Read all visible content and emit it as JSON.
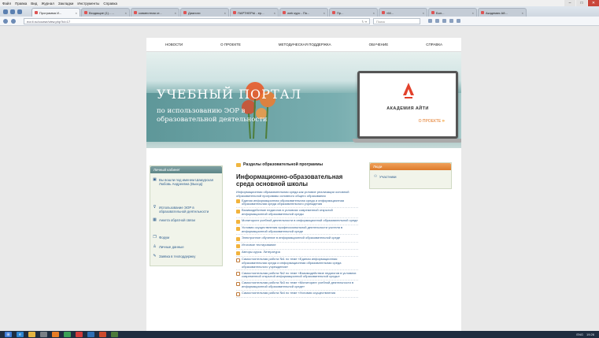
{
  "browser": {
    "menu": [
      "Файл",
      "Правка",
      "Вид",
      "Журнал",
      "Закладки",
      "Инструменты",
      "Справка"
    ],
    "tabs": [
      {
        "label": "Программа И...",
        "active": true
      },
      {
        "label": "Входящие (1) - ...",
        "active": false
      },
      {
        "label": "совместная ст...",
        "active": false
      },
      {
        "label": "Диалоги",
        "active": false
      },
      {
        "label": "ПАРТНЕРЫ - ер...",
        "active": false
      },
      {
        "label": "web курс - По...",
        "active": false
      },
      {
        "label": "Пр...",
        "active": false
      },
      {
        "label": "«М...",
        "active": false
      },
      {
        "label": "Бол...",
        "active": false
      },
      {
        "label": "Академия Ай...",
        "active": false
      }
    ],
    "url": "eor.it.ru/course/view.php?id=17",
    "search_placeholder": "Поиск",
    "window_buttons": [
      "–",
      "□",
      "✕"
    ]
  },
  "site": {
    "nav": [
      "НОВОСТИ",
      "О ПРОЕКТЕ",
      "МЕТОДИЧЕСКАЯ ПОДДЕРЖКА",
      "ОБУЧЕНИЕ",
      "СПРАВКА"
    ],
    "banner": {
      "title_big": "УЧЕБНЫЙ ПОРТАЛ",
      "title_small": "по использованию ЭОР в образовательной деятельности",
      "brand": "АКАДЕМИЯ АЙТИ",
      "about_link": "О ПРОЕКТЕ"
    }
  },
  "sidebar": {
    "heading": "Личный кабинет",
    "user": "Вы вошли под именем Шамурская Любовь Андреевна (Выход)",
    "items": [
      "Использование ЭОР в образовательной деятельности",
      "Анкета обратной связи",
      "Форум",
      "Личные данные",
      "Заявка в техподдержку"
    ]
  },
  "main": {
    "section_title": "Разделы образовательной программы",
    "course_title": "Информационно-образовательная среда основной школы",
    "intro_link": "Информационная образовательная среда как условие реализации основной образовательной программы основного общего образования",
    "modules": [
      {
        "icon": "folder",
        "text": "Единая информационная образовательная среда и информационная образовательная среда образовательного учреждения"
      },
      {
        "icon": "folder",
        "text": "Взаимодействие педагогов в условиях современной открытой информационной образовательной среды"
      },
      {
        "icon": "folder",
        "text": "Мониторинг учебной деятельности в информационной образовательной среде"
      },
      {
        "icon": "folder",
        "text": "Условия осуществления профессиональной деятельности учителя в информационной образовательной среде"
      },
      {
        "icon": "folder",
        "text": "Электронное обучение в информационной образовательной среде"
      },
      {
        "icon": "folder",
        "text": "Итоговое тестирование"
      },
      {
        "icon": "folder",
        "text": "Авторы курса. Литература"
      },
      {
        "icon": "doc",
        "text": "Самостоятельная работа №1 по теме «Единая информационная образовательная среда и информационная образовательная среда образовательного учреждения»"
      },
      {
        "icon": "doc",
        "text": "Самостоятельная работа №2 по теме «Взаимодействие педагогов в условиях современной открытой информационной образовательной среды»"
      },
      {
        "icon": "doc",
        "text": "Самостоятельная работа №3 по теме «Мониторинг учебной деятельности в информационной образовательной среде»"
      },
      {
        "icon": "doc",
        "text": "Самостоятельная работа №4 по теме «Условия осуществления"
      }
    ]
  },
  "people": {
    "heading": "Люди",
    "participants": "Участники"
  },
  "taskbar": {
    "lang": "ENG",
    "time": "19:26"
  }
}
